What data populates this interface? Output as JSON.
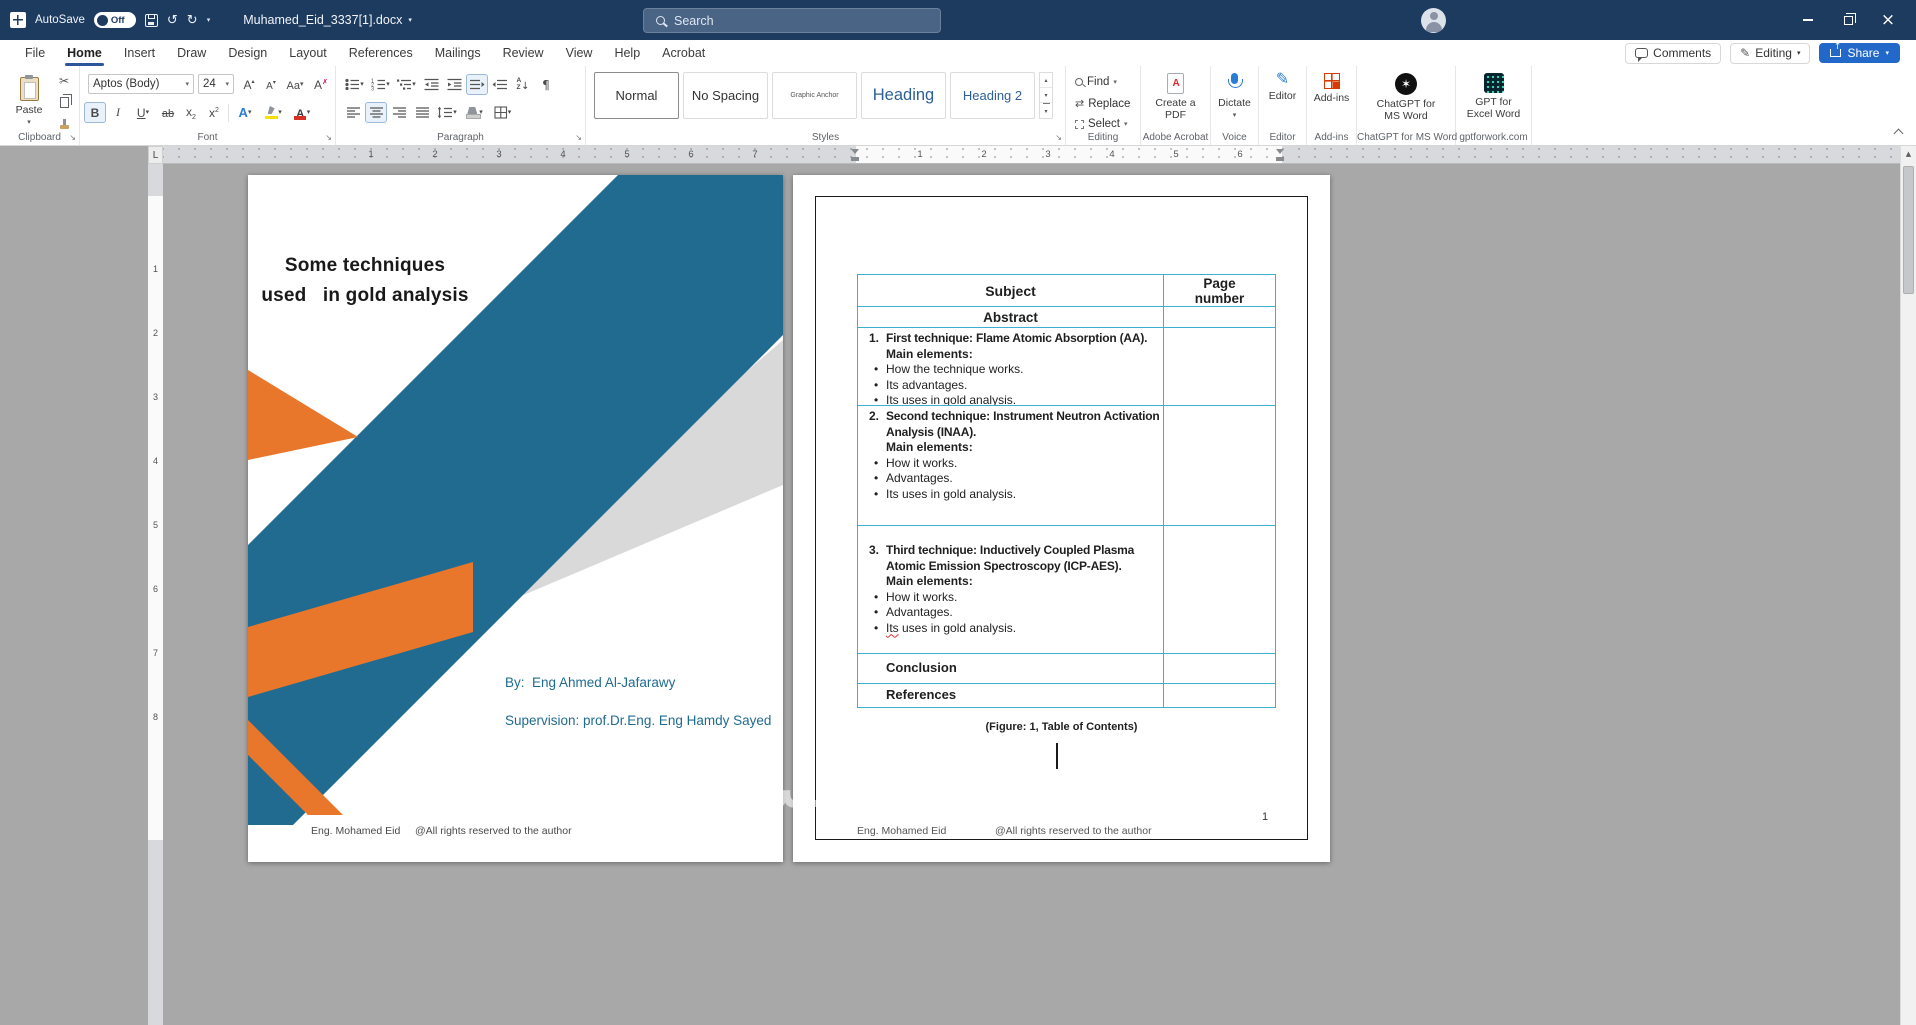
{
  "titlebar": {
    "autosave_label": "AutoSave",
    "autosave_state": "Off",
    "doc_title": "Muhamed_Eid_3337[1].docx",
    "search_placeholder": "Search"
  },
  "tabs": [
    "File",
    "Home",
    "Insert",
    "Draw",
    "Design",
    "Layout",
    "References",
    "Mailings",
    "Review",
    "View",
    "Help",
    "Acrobat"
  ],
  "actions": {
    "comments": "Comments",
    "editing": "Editing",
    "share": "Share"
  },
  "ribbon": {
    "clipboard": {
      "label": "Clipboard",
      "paste": "Paste"
    },
    "font": {
      "label": "Font",
      "font_name": "Aptos (Body)",
      "font_size": "24"
    },
    "paragraph": {
      "label": "Paragraph"
    },
    "styles": {
      "label": "Styles",
      "gallery": [
        "Normal",
        "No Spacing",
        "Graphic Anchor",
        "Heading",
        "Heading 2"
      ]
    },
    "editing": {
      "label": "Editing",
      "find": "Find",
      "replace": "Replace",
      "select": "Select"
    },
    "acrobat": {
      "label": "Adobe Acrobat",
      "button": "Create a PDF"
    },
    "voice": {
      "label": "Voice",
      "button": "Dictate"
    },
    "editor": {
      "label": "Editor",
      "button": "Editor"
    },
    "addins": {
      "label": "Add-ins",
      "button": "Add-ins"
    },
    "chatgpt": {
      "label": "ChatGPT for MS Word",
      "button": "ChatGPT for MS Word"
    },
    "gptexcel": {
      "label": "gptforwork.com",
      "button": "GPT for Excel Word"
    }
  },
  "ruler": {
    "tab_selector": "L",
    "h_left": [
      "1",
      "2",
      "3",
      "4",
      "5",
      "6",
      "7"
    ],
    "h_right": [
      "1",
      "2",
      "3",
      "4",
      "5",
      "6"
    ],
    "v": [
      "1",
      "2",
      "3",
      "4",
      "5",
      "6",
      "7",
      "8"
    ]
  },
  "cover": {
    "title_line1": "Some techniques",
    "title_line2": "used   in gold analysis",
    "by_line": "By:  Eng Ahmed Al-Jafarawy",
    "supervision_line": "Supervision: prof.Dr.Eng. Eng Hamdy Sayed",
    "footer_name": "Eng. Mohamed Eid",
    "footer_rights": "@All rights reserved to the author"
  },
  "toc": {
    "col_subject": "Subject",
    "col_page": "Page number",
    "abstract": "Abstract",
    "items": [
      {
        "num": "1.",
        "title": "First technique: Flame Atomic Absorption (AA).",
        "sub": "Main elements:",
        "b0": "How the technique works.",
        "b1": "Its advantages.",
        "b2": "Its uses in gold analysis."
      },
      {
        "num": "2.",
        "title": "Second technique: Instrument Neutron Activation Analysis (INAA).",
        "sub": "Main elements:",
        "b0": "How it works.",
        "b1": "Advantages.",
        "b2": "Its uses in gold analysis."
      },
      {
        "num": "3.",
        "title": "Third technique: Inductively Coupled Plasma Atomic Emission Spectroscopy (ICP-AES).",
        "sub": "Main elements:",
        "b0": "How it works.",
        "b1": "Advantages.",
        "b2a": "Its",
        "b2b": " uses in gold analysis."
      }
    ],
    "conclusion": "Conclusion",
    "references": "References",
    "caption": "(Figure: 1, Table of Contents)",
    "page_number": "1",
    "footer_name": "Eng. Mohamed Eid",
    "footer_rights": "@All rights reserved to the author"
  },
  "watermark": "خمسات",
  "colors": {
    "titlebar_bg": "#1d3a5f",
    "search_bg": "#4a6486",
    "accent_blue": "#2b579a",
    "share_bg": "#2268c8",
    "icon_blue": "#2b7cd3",
    "teal_band": "#226b90",
    "orange_accent": "#e8762b",
    "gray_band": "#d9d9d9",
    "teal_text": "#1f6b90",
    "heading_blue": "#2e5f95",
    "table_border": "#3fafd0",
    "addin_red": "#d83b01"
  }
}
